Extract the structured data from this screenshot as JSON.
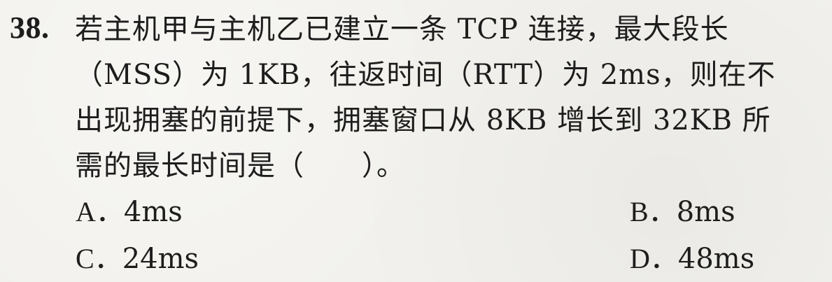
{
  "question": {
    "number": "38.",
    "lines": [
      "若主机甲与主机乙已建立一条 TCP 连接，最大段长",
      "（MSS）为 1KB，往返时间（RTT）为 2ms，则在不",
      "出现拥塞的前提下，拥塞窗口从 8KB 增长到 32KB 所",
      "需的最长时间是（　　）。"
    ]
  },
  "options": [
    {
      "letter": "A．",
      "text": "4ms"
    },
    {
      "letter": "B．",
      "text": "8ms"
    },
    {
      "letter": "C．",
      "text": "24ms"
    },
    {
      "letter": "D．",
      "text": "48ms"
    }
  ]
}
